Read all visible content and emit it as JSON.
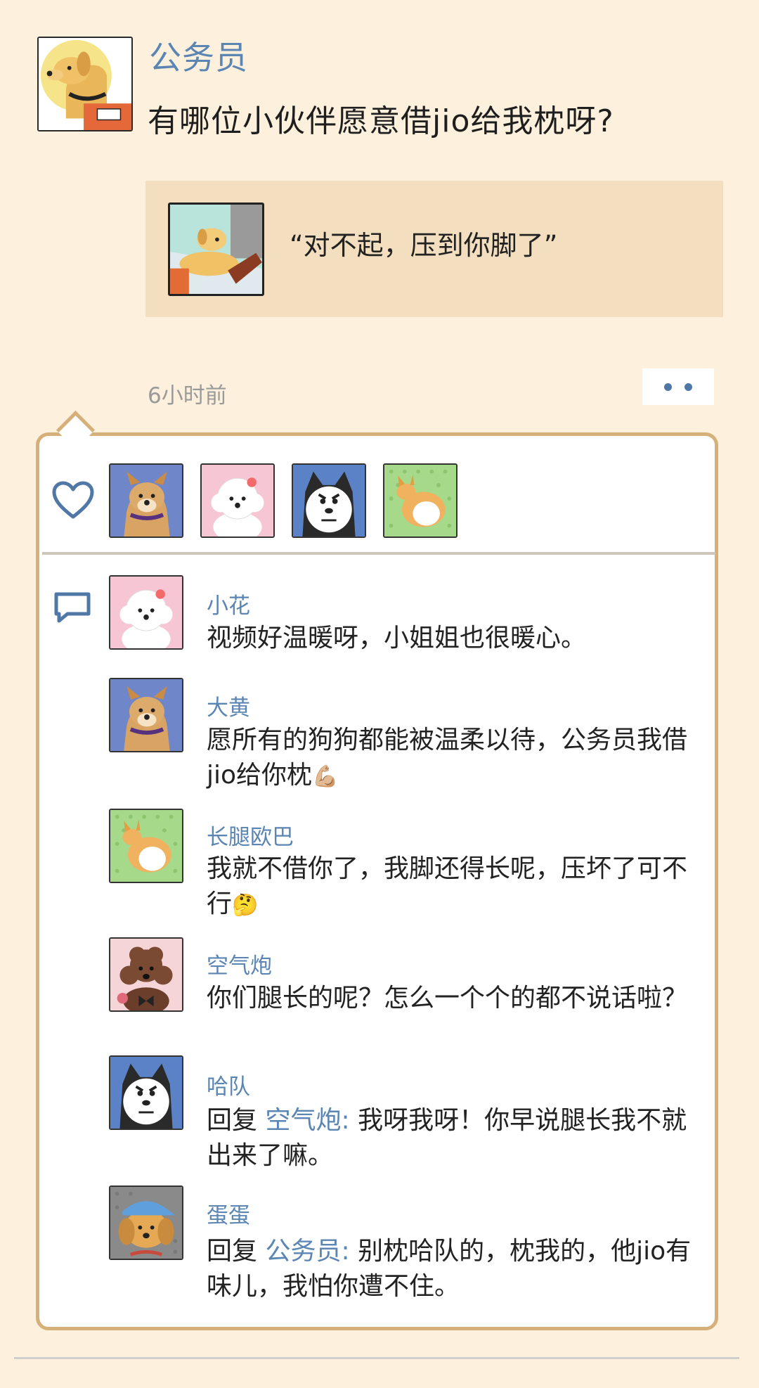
{
  "post": {
    "author": "公务员",
    "text": "有哪位小伙伴愿意借jio给我枕呀?",
    "avatar_icon": "guide-dog-avatar-icon"
  },
  "shared_card": {
    "quote": "“对不起，压到你脚了”",
    "thumbnail_icon": "dog-sleeping-on-foot-thumbnail"
  },
  "meta": {
    "time": "6小时前",
    "more_icon": "two-dots-more-icon"
  },
  "likes": {
    "icon": "heart-outline-icon",
    "users": [
      {
        "avatar_icon": "shiba-dog-avatar-icon",
        "bg": "#6f86c8"
      },
      {
        "avatar_icon": "white-poodle-avatar-icon",
        "bg": "#f6c6d4"
      },
      {
        "avatar_icon": "husky-avatar-icon",
        "bg": "#5b82c6"
      },
      {
        "avatar_icon": "corgi-avatar-icon",
        "bg": "#a7d98b"
      }
    ]
  },
  "comments": {
    "icon": "speech-bubble-icon",
    "items": [
      {
        "name": "小花",
        "text": "视频好温暖呀，小姐姐也很暖心。",
        "avatar_icon": "white-poodle-avatar-icon"
      },
      {
        "name": "大黄",
        "text": "愿所有的狗狗都能被温柔以待，公务员我借jio给你枕",
        "emoji": "💪🏼",
        "avatar_icon": "shiba-dog-avatar-icon"
      },
      {
        "name": "长腿欧巴",
        "text": "我就不借你了，我脚还得长呢，压坏了可不行",
        "emoji": "🤔",
        "avatar_icon": "corgi-avatar-icon"
      },
      {
        "name": "空气炮",
        "text": "你们腿长的呢？怎么一个个的都不说话啦？",
        "avatar_icon": "brown-poodle-avatar-icon"
      },
      {
        "name": "哈队",
        "reply_label": "回复",
        "reply_to": "空气炮:",
        "text": "我呀我呀！你早说腿长我不就出来了嘛。",
        "avatar_icon": "husky-avatar-icon"
      },
      {
        "name": "蛋蛋",
        "reply_label": "回复",
        "reply_to": "公务员:",
        "text": "别枕哈队的，枕我的，他jio有味儿，我怕你遭不住。",
        "avatar_icon": "golden-retriever-cap-avatar-icon"
      }
    ]
  }
}
